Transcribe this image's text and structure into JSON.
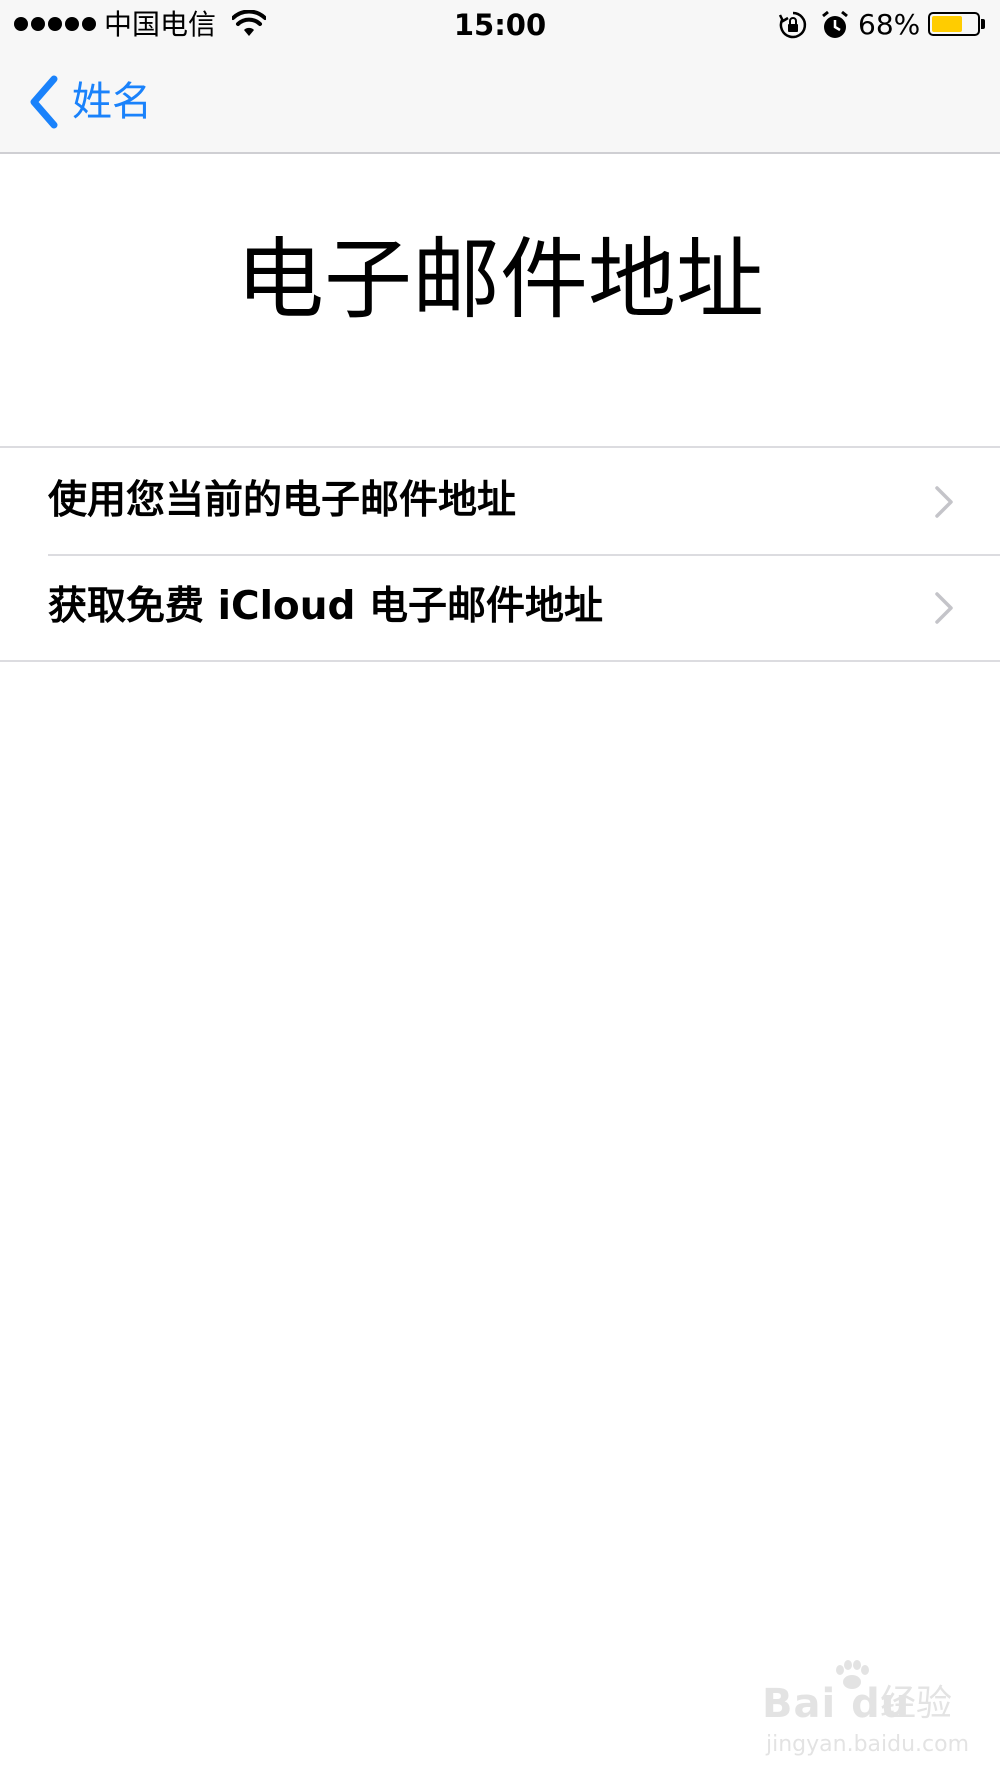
{
  "status_bar": {
    "carrier": "中国电信",
    "time": "15:00",
    "battery_percent": "68%",
    "battery_level": 0.68,
    "signal_bars": 5,
    "icons": [
      "signal-dots-icon",
      "wifi-icon",
      "rotation-lock-icon",
      "alarm-icon",
      "battery-icon"
    ]
  },
  "nav": {
    "back_label": "姓名",
    "accent_color": "#1a82fb"
  },
  "main": {
    "title": "电子邮件地址",
    "options": [
      {
        "label": "使用您当前的电子邮件地址"
      },
      {
        "label": "获取免费 iCloud 电子邮件地址"
      }
    ]
  },
  "watermark": {
    "logo": "Bai du",
    "product": "经验",
    "url": "jingyan.baidu.com"
  }
}
